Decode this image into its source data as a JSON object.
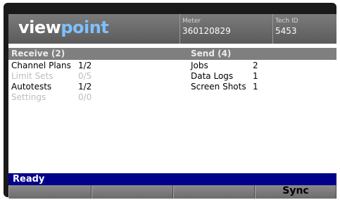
{
  "header": {
    "logo_part1": "view",
    "logo_part2": "point",
    "meter_label": "Meter",
    "meter_value": "360120829",
    "tech_label": "Tech ID",
    "tech_value": "5453"
  },
  "receive": {
    "heading": "Receive (2)",
    "items": [
      {
        "label": "Channel Plans",
        "value": "1/2",
        "enabled": true
      },
      {
        "label": "Limit Sets",
        "value": "0/5",
        "enabled": false
      },
      {
        "label": "Autotests",
        "value": "1/2",
        "enabled": true
      },
      {
        "label": "Settings",
        "value": "0/0",
        "enabled": false
      }
    ]
  },
  "send": {
    "heading": "Send (4)",
    "items": [
      {
        "label": "Jobs",
        "value": "2"
      },
      {
        "label": "Data Logs",
        "value": "1"
      },
      {
        "label": "Screen Shots",
        "value": "1"
      }
    ]
  },
  "status": {
    "text": "Ready"
  },
  "softkeys": [
    "",
    "",
    "",
    "Sync"
  ],
  "colors": {
    "status_bar": "#00008b",
    "logo_accent": "#7ec0ff",
    "header": "#6b6b6b"
  }
}
